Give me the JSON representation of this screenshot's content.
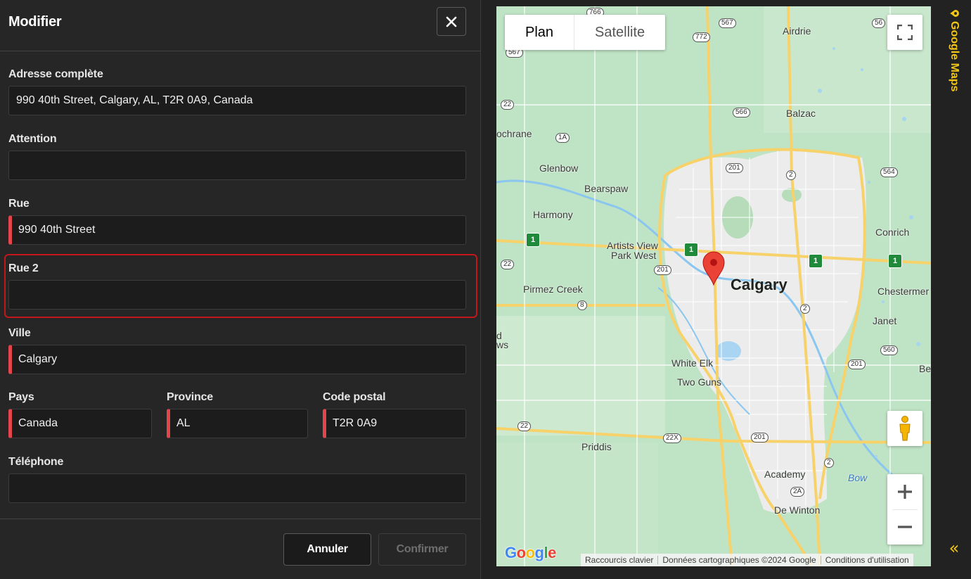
{
  "dialog": {
    "title": "Modifier",
    "close_icon": "close-icon",
    "fields": {
      "full_address": {
        "label": "Adresse complète",
        "value": "990 40th Street, Calgary, AL, T2R 0A9, Canada"
      },
      "attention": {
        "label": "Attention",
        "value": ""
      },
      "street": {
        "label": "Rue",
        "value": "990 40th Street"
      },
      "street2": {
        "label": "Rue 2",
        "value": ""
      },
      "city": {
        "label": "Ville",
        "value": "Calgary"
      },
      "country": {
        "label": "Pays",
        "value": "Canada"
      },
      "province": {
        "label": "Province",
        "value": "AL"
      },
      "postal_code": {
        "label": "Code postal",
        "value": "T2R 0A9"
      },
      "phone": {
        "label": "Téléphone",
        "value": ""
      }
    },
    "buttons": {
      "cancel": "Annuler",
      "confirm": "Confirmer"
    },
    "colors": {
      "required_marker": "#e2454b",
      "focus_ring": "#c3171b"
    }
  },
  "map": {
    "types": {
      "plan": "Plan",
      "satellite": "Satellite"
    },
    "selected_type": "Plan",
    "places": {
      "calgary": "Calgary",
      "airdrie": "Airdrie",
      "balzac": "Balzac",
      "cochrane": "ochrane",
      "glenbow": "Glenbow",
      "bearspaw": "Bearspaw",
      "harmony": "Harmony",
      "artists_view": "Artists View",
      "park_west": "Park West",
      "pirmez_creek": "Pirmez Creek",
      "conrich": "Conrich",
      "chestermere": "Chestermer",
      "janet": "Janet",
      "white_elk": "White Elk",
      "two_guns": "Two Guns",
      "priddis": "Priddis",
      "academy": "Academy",
      "de_winton": "De Winton",
      "bow": "Bow",
      "be": "Be",
      "d": "d",
      "ws": "ws"
    },
    "shields": {
      "s766": "766",
      "s567a": "567",
      "s567b": "567",
      "s772": "772",
      "s56": "56",
      "s22a": "22",
      "s1a": "1A",
      "s566": "566",
      "s201a": "201",
      "s2a": "2",
      "s564": "564",
      "s22b": "22",
      "s201b": "201",
      "s8": "8",
      "s2b": "2",
      "s560": "560",
      "s201c": "201",
      "s22c": "22",
      "s22x": "22X",
      "s201d": "201",
      "s2c": "2",
      "s2A": "2A",
      "tch1": "1",
      "tch2": "1",
      "tch3": "1",
      "tch4": "1"
    },
    "attribution": {
      "shortcuts": "Raccourcis clavier",
      "data": "Données cartographiques ©2024 Google",
      "terms": "Conditions d'utilisation"
    },
    "logo": {
      "G": "G",
      "o1": "o",
      "o2": "o",
      "g": "g",
      "l": "l",
      "e": "e"
    },
    "icons": {
      "fullscreen": "fullscreen-icon",
      "pegman": "pegman-icon",
      "zoom_in": "plus-icon",
      "zoom_out": "minus-icon",
      "marker": "map-marker-icon"
    }
  },
  "rail": {
    "title": "Google Maps",
    "collapse_glyph": "«",
    "accent": "#f3c613"
  }
}
